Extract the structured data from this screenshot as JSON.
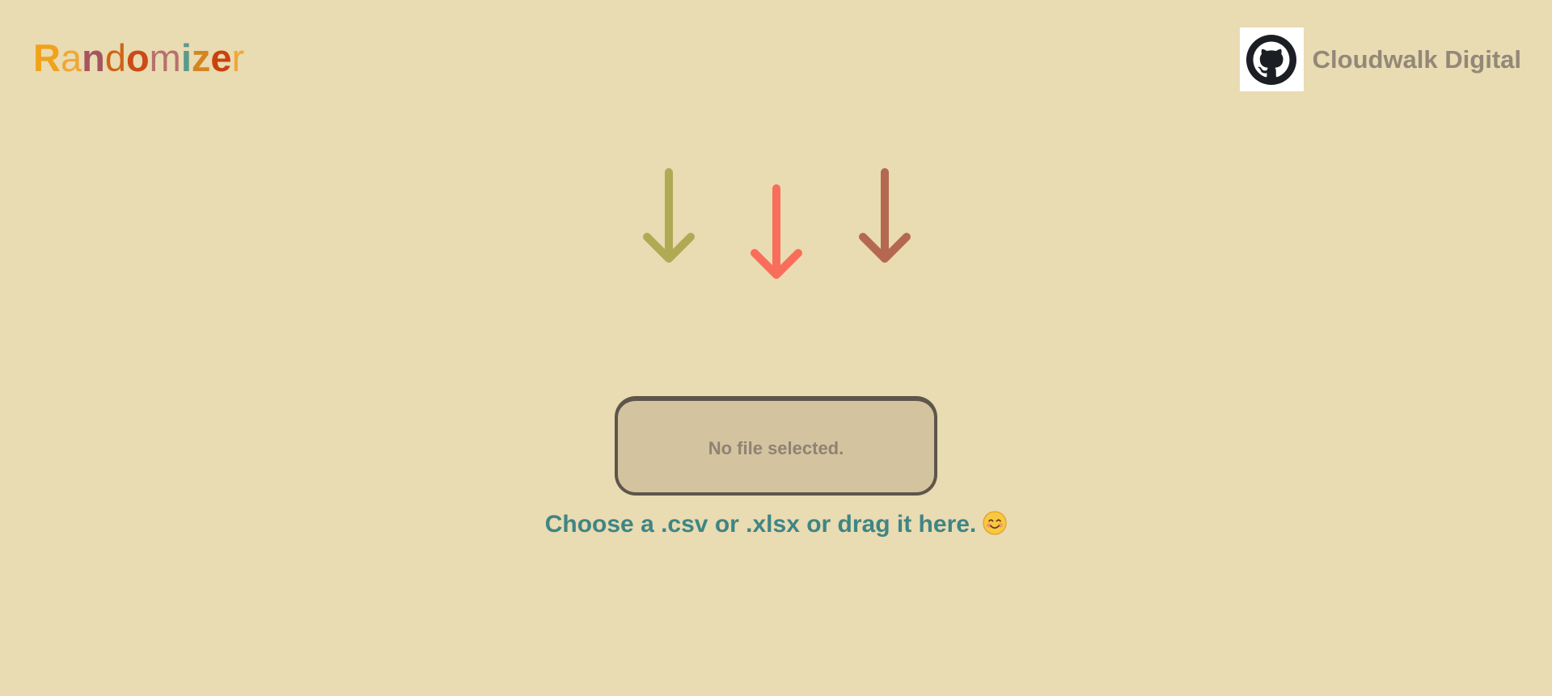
{
  "header": {
    "logo_letters": [
      "R",
      "a",
      "n",
      "d",
      "o",
      "m",
      "i",
      "z",
      "e",
      "r"
    ],
    "logo_colors": [
      "#f0a21a",
      "#f1a635",
      "#a6555f",
      "#cf6417",
      "#cb4b16",
      "#b7716c",
      "#5b9a8b",
      "#d38620",
      "#c9420d",
      "#f1a635"
    ],
    "github_icon": "github-octocat-icon",
    "github_label": "Cloudwalk Digital"
  },
  "arrows": {
    "icon": "down-arrow-icon",
    "colors": [
      "#b1aa55",
      "#f96e5b",
      "#b46852"
    ]
  },
  "upload": {
    "status_text": "No file selected.",
    "hint_text": "Choose a .csv or .xlsx or drag it here.",
    "hint_emoji": "smiling-face-icon"
  },
  "colors": {
    "background": "#e9dbb2",
    "dropzone_fill": "#d4c39f",
    "dropzone_border": "#5e564a",
    "hint": "#3f8584",
    "muted_text": "#938878"
  }
}
